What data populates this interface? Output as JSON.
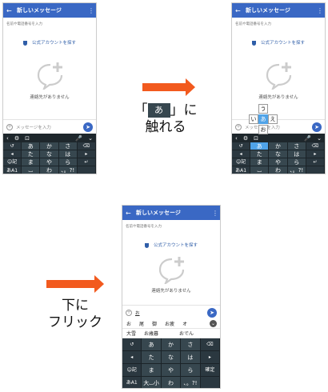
{
  "screen": {
    "title": "新しいメッセージ",
    "back_icon": "arrow-left-icon",
    "menu_icon": "more-vert-icon",
    "search_hint": "名前や電話番号を入力",
    "official_account": "公式アカウントを探す",
    "no_contacts": "連絡先がありません",
    "input_placeholder": "メッセージを入力",
    "send_icon": "send-icon",
    "toolbar": [
      "‹",
      "⚙",
      "⊡",
      "🎤",
      "⌄"
    ],
    "keys": [
      [
        "↺",
        "あ",
        "か",
        "さ",
        "⌫"
      ],
      [
        "◂",
        "た",
        "な",
        "は",
        "▸"
      ],
      [
        "☺記",
        "ま",
        "や",
        "ら",
        "↵"
      ],
      [
        "あA1",
        "⌴",
        "わ",
        "、。?!",
        ""
      ]
    ],
    "flick_keys": {
      "up": "う",
      "left": "い",
      "center": "あ",
      "right": "え",
      "down": "お"
    }
  },
  "phone3": {
    "input_text": "お",
    "candidates_row1": [
      "お",
      "尾",
      "御",
      "お疲",
      "オ"
    ],
    "candidates_row2": [
      "大雪",
      "お歳暮",
      "おでん"
    ],
    "keys": [
      [
        "↺",
        "あ",
        "か",
        "さ",
        "⌫"
      ],
      [
        "◂",
        "た",
        "な",
        "は",
        "▸"
      ],
      [
        "☺記",
        "ま",
        "や",
        "ら",
        "確定"
      ],
      [
        "あA1",
        "大⌴小",
        "わ",
        "、。?!",
        ""
      ]
    ]
  },
  "instructions": {
    "touch_prefix": "「",
    "touch_key": "あ",
    "touch_suffix": "」に",
    "touch_line2": "触れる",
    "flick_line1": "下に",
    "flick_line2": "フリック"
  },
  "colors": {
    "accent": "#3a68c4",
    "arrow": "#f25a1e",
    "keyboard": "#263238",
    "highlight": "#4fa3e8"
  }
}
